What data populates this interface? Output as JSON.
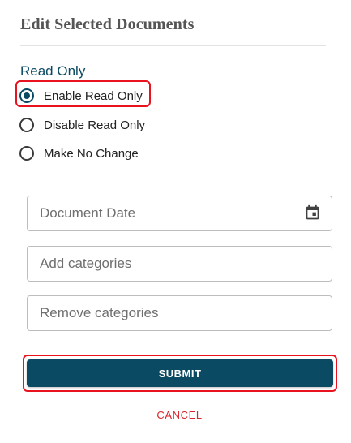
{
  "dialog": {
    "title": "Edit Selected Documents"
  },
  "read_only": {
    "label": "Read Only",
    "options": [
      {
        "label": "Enable Read Only",
        "selected": true
      },
      {
        "label": "Disable Read Only",
        "selected": false
      },
      {
        "label": "Make No Change",
        "selected": false
      }
    ]
  },
  "fields": {
    "document_date": {
      "placeholder": "Document Date",
      "value": ""
    },
    "add_categories": {
      "placeholder": "Add categories",
      "value": ""
    },
    "remove_categories": {
      "placeholder": "Remove categories",
      "value": ""
    }
  },
  "icons": {
    "date_picker": "calendar-icon"
  },
  "actions": {
    "submit_label": "SUBMIT",
    "cancel_label": "CANCEL"
  },
  "colors": {
    "primary": "#0b4a63",
    "cancel": "#d8262e",
    "highlight": "#e8131f",
    "title": "#555555"
  }
}
